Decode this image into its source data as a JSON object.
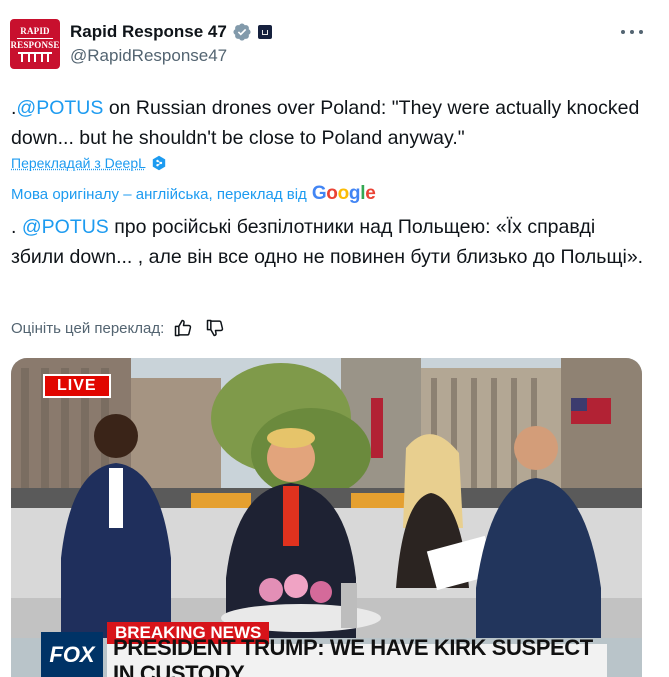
{
  "author": {
    "display_name": "Rapid Response 47",
    "handle": "@RapidResponse47",
    "avatar_text": [
      "RAPID",
      "RESPONSE"
    ],
    "avatar_icon": "white-house-icon",
    "verified_icon": "verified-badge-icon",
    "affiliation_icon": "white-house-affiliate-icon"
  },
  "more_icon": "more-options-icon",
  "tweet": {
    "prefix": ".",
    "mention": "@POTUS",
    "text": " on Russian drones over Poland: \"They were actually knocked down... but he shouldn't be close to Poland anyway.\""
  },
  "translation": {
    "deepl_link": "Перекладай з DeepL",
    "deepl_icon": "deepl-icon",
    "original_language": "Мова оригіналу – англійська, переклад від",
    "google_letters": [
      "G",
      "o",
      "o",
      "g",
      "l",
      "e"
    ],
    "prefix": ". ",
    "mention": "@POTUS",
    "text": " про російські безпілотники над Польщею: «Їх справді збили down... , але він все одно не повинен бути близько до Польщі».",
    "rate_label": "Оцініть цей переклад:",
    "thumbs_up_icon": "thumbs-up-icon",
    "thumbs_down_icon": "thumbs-down-icon"
  },
  "media": {
    "live_label": "LIVE",
    "breaking_label": "BREAKING NEWS",
    "headline": "PRESIDENT TRUMP: WE HAVE KIRK SUSPECT IN CUSTODY",
    "network_logo": "FOX NEWS",
    "network_logo_text": "FOX"
  },
  "colors": {
    "accent": "#1d9bf0",
    "text": "#0f1419",
    "muted": "#536471",
    "avatar_red": "#c8102e",
    "breaking_red": "#d7141a"
  }
}
